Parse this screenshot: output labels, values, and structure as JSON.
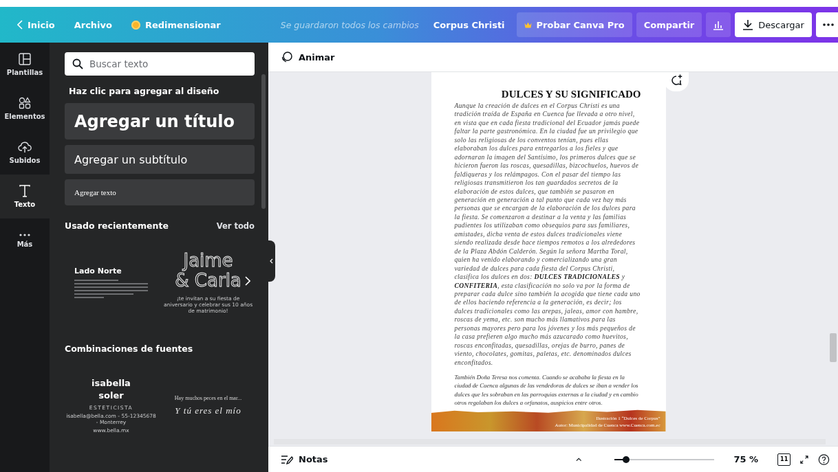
{
  "top_bar": {
    "back": "Inicio",
    "menu": "Archivo",
    "resize": "Redimensionar",
    "save_status": "Se guardaron todos los cambios",
    "doc_title": "Corpus Christi",
    "pro": "Probar Canva Pro",
    "share": "Compartir",
    "download": "Descargar"
  },
  "rail": [
    {
      "kind": "templates",
      "label": "Plantillas",
      "selected": false
    },
    {
      "kind": "elements",
      "label": "Elementos",
      "selected": false
    },
    {
      "kind": "uploads",
      "label": "Subidos",
      "selected": false
    },
    {
      "kind": "text",
      "label": "Texto",
      "selected": true
    },
    {
      "kind": "more",
      "label": "Más",
      "selected": false
    }
  ],
  "panel": {
    "search_placeholder": "Buscar texto",
    "hint": "Haz clic para agregar al diseño",
    "add_buttons": [
      {
        "kind": "title",
        "label": "Agregar un título"
      },
      {
        "kind": "subtitle",
        "label": "Agregar un subtítulo"
      },
      {
        "kind": "body",
        "label": "Agregar texto"
      }
    ],
    "recent": {
      "heading": "Usado recientemente",
      "see_all": "Ver todo",
      "templates": [
        {
          "kind": "plain",
          "title": "Lado Norte"
        },
        {
          "kind": "outline",
          "lines": [
            "Jaime",
            "& Carla"
          ],
          "subtitle": "¡te invitan a su fiesta de aniversario y celebrar sus 10 años de matrimonio!"
        }
      ]
    },
    "combos": {
      "heading": "Combinaciones de fuentes",
      "items": [
        {
          "kind": "card",
          "lines": [
            "isabella",
            "soler"
          ],
          "role": "ESTETICISTA",
          "contact": "isabella@bella.com - 55-12345678 - Monterrey",
          "web": "www.bella.mx"
        },
        {
          "kind": "script",
          "line": "Hay muchos peces en el mar...",
          "script": "Y tú eres el mío"
        }
      ]
    }
  },
  "toolbar": {
    "animate": "Animar"
  },
  "document": {
    "title": "DULCES Y SU SIGNIFICADO",
    "paragraphs": [
      "Aunque la creación de dulces en el Corpus Christi es una tradición traída de España en Cuenca fue llevada a otro nivel, en vista que en cada fiesta tradicional del Ecuador jamás puede faltar la parte gastronómica. En la ciudad fue un privilegio que solo las religiosas de los conventos tenían, pues ellas elaboraban los dulces para entregarlos a los fieles y que adornaran la imagen del Santísimo, los primeros dulces que se hicieron fueron las roscas, quesadillas, bizcochuelos, huevos de faldiqueras y los relámpagos. Con el pasar del tiempo las religiosas transmitieron los tan guardados secretos de la elaboración de estos dulces, que también se pasaron en generación en generación a tal punto que cada vez hay más personas que se encargan de la elaboración de los dulces para la fiesta. Se comenzaron a destinar a la venta y las familias pudientes los utilizaban como obsequios para sus familiares, amistades, dicha venta de estos dulces tradicionales viene siendo realizada desde hace tiempos remotos a los alrededores de la Plaza Abdón Calderón. Según la señora Martha Toral, quien ha venido elaborando y comercializando una gran variedad de dulces para cada fiesta del Corpus Christi, clasifica los dulces en dos: **DULCES TRADICIONALES** y **CONFITERIA**, esta clasificación no solo va por la forma de preparar cada dulce sino también la acogida que tiene cada uno de ellos haciendo referencia a la generación, es decir; los dulces tradicionales como las arepas, jaleas, amor con hambre, roscas de yema, etc. son mucho más llamativos para las personas mayores pero para los jóvenes y los más pequeños de la casa prefieren algo mucho más azucarado como huevitos, roscas enconfitadas, quesadillas, orejas de burro, panes de viento, chocolates, gomitas, paletas, etc. denominados dulces enconfitados.",
      "También Doña Teresa nos comenta. Cuando se acababa la fiesta en la ciudad de Cuenca algunas de las vendedoras de dulces se iban a vender los dulces que les sobraban en las parroquias externas a la ciudad y en cambio otros regalaban los dulces a orfanatos, auspicios entre otros."
    ],
    "caption": [
      "Ilustración 1 “Dulces de Corpus”",
      "Autor: Municipalidad de Cuenca www.Cuenca.com.ec"
    ]
  },
  "bottom_bar": {
    "notes": "Notas",
    "zoom_slider": {
      "level": 0.12
    },
    "zoom": "75 %",
    "page_count": "11"
  }
}
